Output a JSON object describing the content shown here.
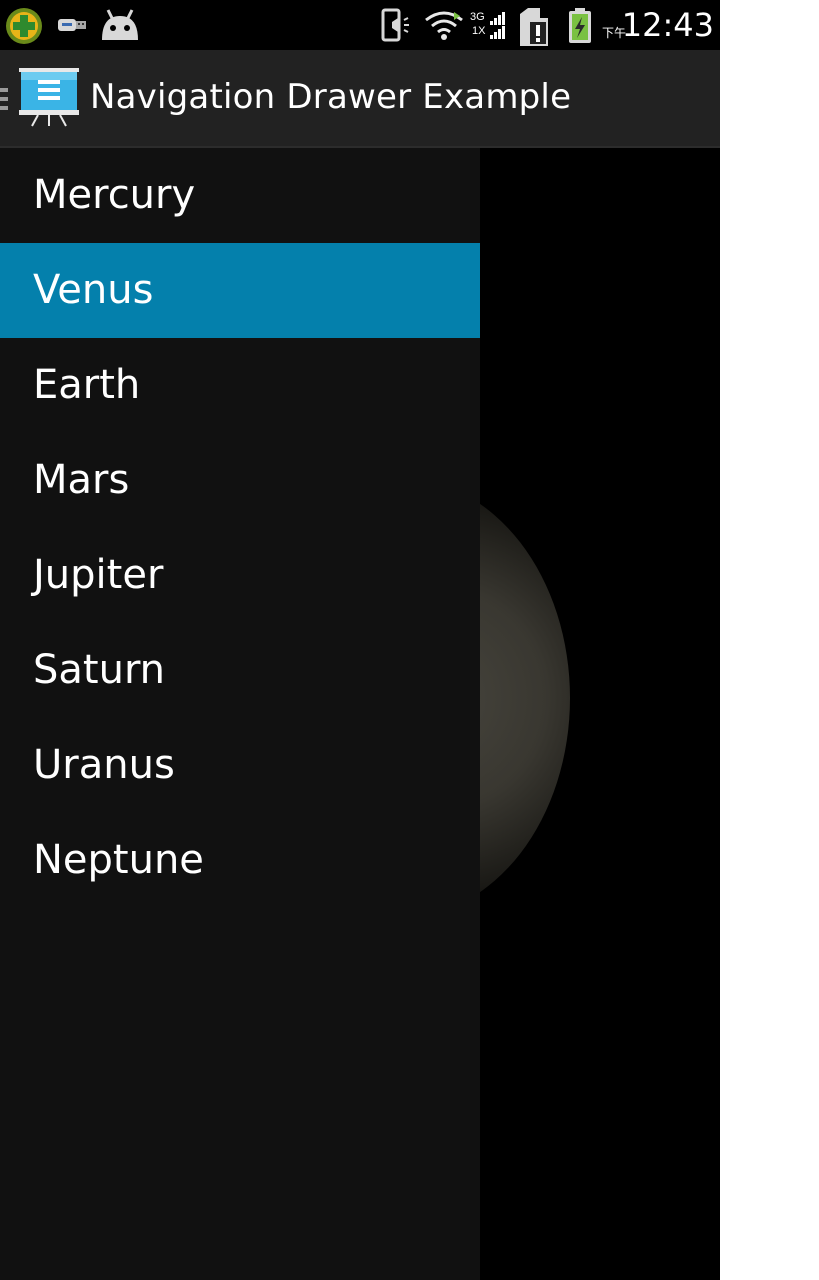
{
  "status_bar": {
    "time": "12:43",
    "ampm": "下午",
    "network": "3G",
    "network2": "1X",
    "icons": [
      "app-badge-icon",
      "usb-icon",
      "android-icon",
      "vibrate-icon",
      "wifi-icon",
      "signal-icon",
      "sim-alert-icon",
      "battery-charging-icon"
    ]
  },
  "action_bar": {
    "title": "Navigation Drawer Example",
    "app_icon": "presentation-icon",
    "drawer_indicator": "drawer-indicator-icon"
  },
  "drawer": {
    "selected_index": 1,
    "accent_color": "#0480ac",
    "items": [
      {
        "label": "Mercury"
      },
      {
        "label": "Venus"
      },
      {
        "label": "Earth"
      },
      {
        "label": "Mars"
      },
      {
        "label": "Jupiter"
      },
      {
        "label": "Saturn"
      },
      {
        "label": "Uranus"
      },
      {
        "label": "Neptune"
      }
    ]
  }
}
